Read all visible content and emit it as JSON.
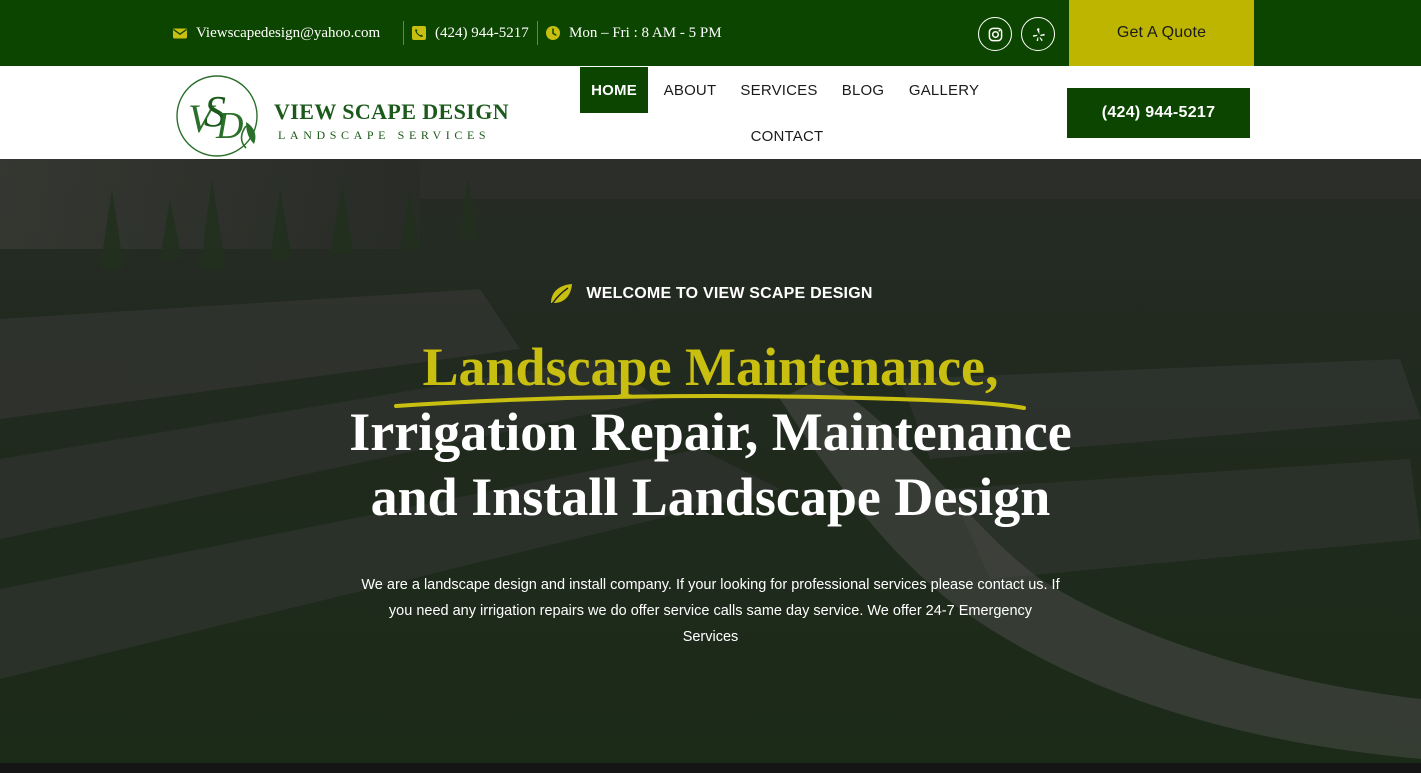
{
  "topbar": {
    "email": "Viewscapedesign@yahoo.com",
    "phone": "(424) 944-5217",
    "hours": "Mon – Fri : 8 AM - 5 PM",
    "quote_label": "Get A Quote"
  },
  "header": {
    "logo_title": "VIEW SCAPE DESIGN",
    "logo_subtitle": "LANDSCAPE SERVICES",
    "nav": [
      "HOME",
      "ABOUT",
      "SERVICES",
      "BLOG",
      "GALLERY",
      "CONTACT"
    ],
    "phone_button": "(424) 944-5217"
  },
  "hero": {
    "kicker": "WELCOME TO VIEW SCAPE DESIGN",
    "headline_highlight": "Landscape Maintenance,",
    "headline_line1": "Irrigation Repair, Maintenance",
    "headline_line2": "and Install Landscape Design",
    "description": "We are a landscape design and install company. If your looking for professional services please contact us. If you need any irrigation repairs we do offer service calls same day service. We offer 24-7 Emergency Services"
  },
  "colors": {
    "brand_green": "#0c4500",
    "accent_yellow": "#bdb500",
    "headline_yellow": "#c8bf10"
  },
  "icons": [
    "email-icon",
    "phone-icon",
    "clock-icon",
    "instagram-icon",
    "yelp-icon",
    "leaf-icon"
  ]
}
